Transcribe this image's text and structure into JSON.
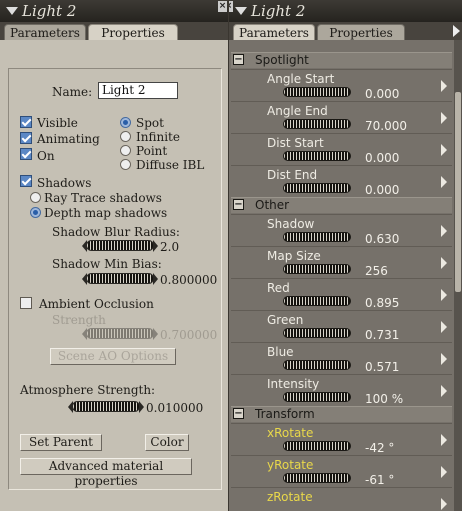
{
  "left_panel": {
    "title": "Light 2",
    "tabs": [
      "Parameters",
      "Properties"
    ],
    "name_label": "Name:",
    "name_value": "Light 2",
    "checks": {
      "visible": "Visible",
      "animating": "Animating",
      "on": "On"
    },
    "light_types": [
      "Spot",
      "Infinite",
      "Point",
      "Diffuse IBL"
    ],
    "shadows_label": "Shadows",
    "shadow_options": [
      "Ray Trace shadows",
      "Depth map shadows"
    ],
    "shadow_blur_label": "Shadow Blur Radius:",
    "shadow_blur_value": "2.0",
    "shadow_bias_label": "Shadow Min Bias:",
    "shadow_bias_value": "0.800000",
    "ambient_label": "Ambient Occlusion",
    "strength_label": "Strength",
    "strength_value": "0.700000",
    "scene_ao_button": "Scene AO Options",
    "atmosphere_label": "Atmosphere Strength:",
    "atmosphere_value": "0.010000",
    "set_parent_button": "Set Parent",
    "color_button": "Color",
    "advanced_button": "Advanced material properties"
  },
  "right_panel": {
    "title": "Light 2",
    "tabs": [
      "Parameters",
      "Properties"
    ],
    "groups": {
      "spotlight": {
        "label": "Spotlight",
        "params": [
          {
            "label": "Angle Start",
            "value": "0.000"
          },
          {
            "label": "Angle End",
            "value": "70.000"
          },
          {
            "label": "Dist Start",
            "value": "0.000"
          },
          {
            "label": "Dist End",
            "value": "0.000"
          }
        ]
      },
      "other": {
        "label": "Other",
        "params": [
          {
            "label": "Shadow",
            "value": "0.630"
          },
          {
            "label": "Map Size",
            "value": "256"
          },
          {
            "label": "Red",
            "value": "0.895"
          },
          {
            "label": "Green",
            "value": "0.731"
          },
          {
            "label": "Blue",
            "value": "0.571"
          },
          {
            "label": "Intensity",
            "value": "100 %"
          }
        ]
      },
      "transform": {
        "label": "Transform",
        "params": [
          {
            "label": "xRotate",
            "value": "-42 °"
          },
          {
            "label": "yRotate",
            "value": "-61 °"
          },
          {
            "label": "zRotate",
            "value": ""
          }
        ]
      }
    }
  },
  "colors": {
    "selected_radio": "#2a5ea8",
    "check_on": "#5c88c5",
    "rotate_label": "#e9d84a"
  }
}
